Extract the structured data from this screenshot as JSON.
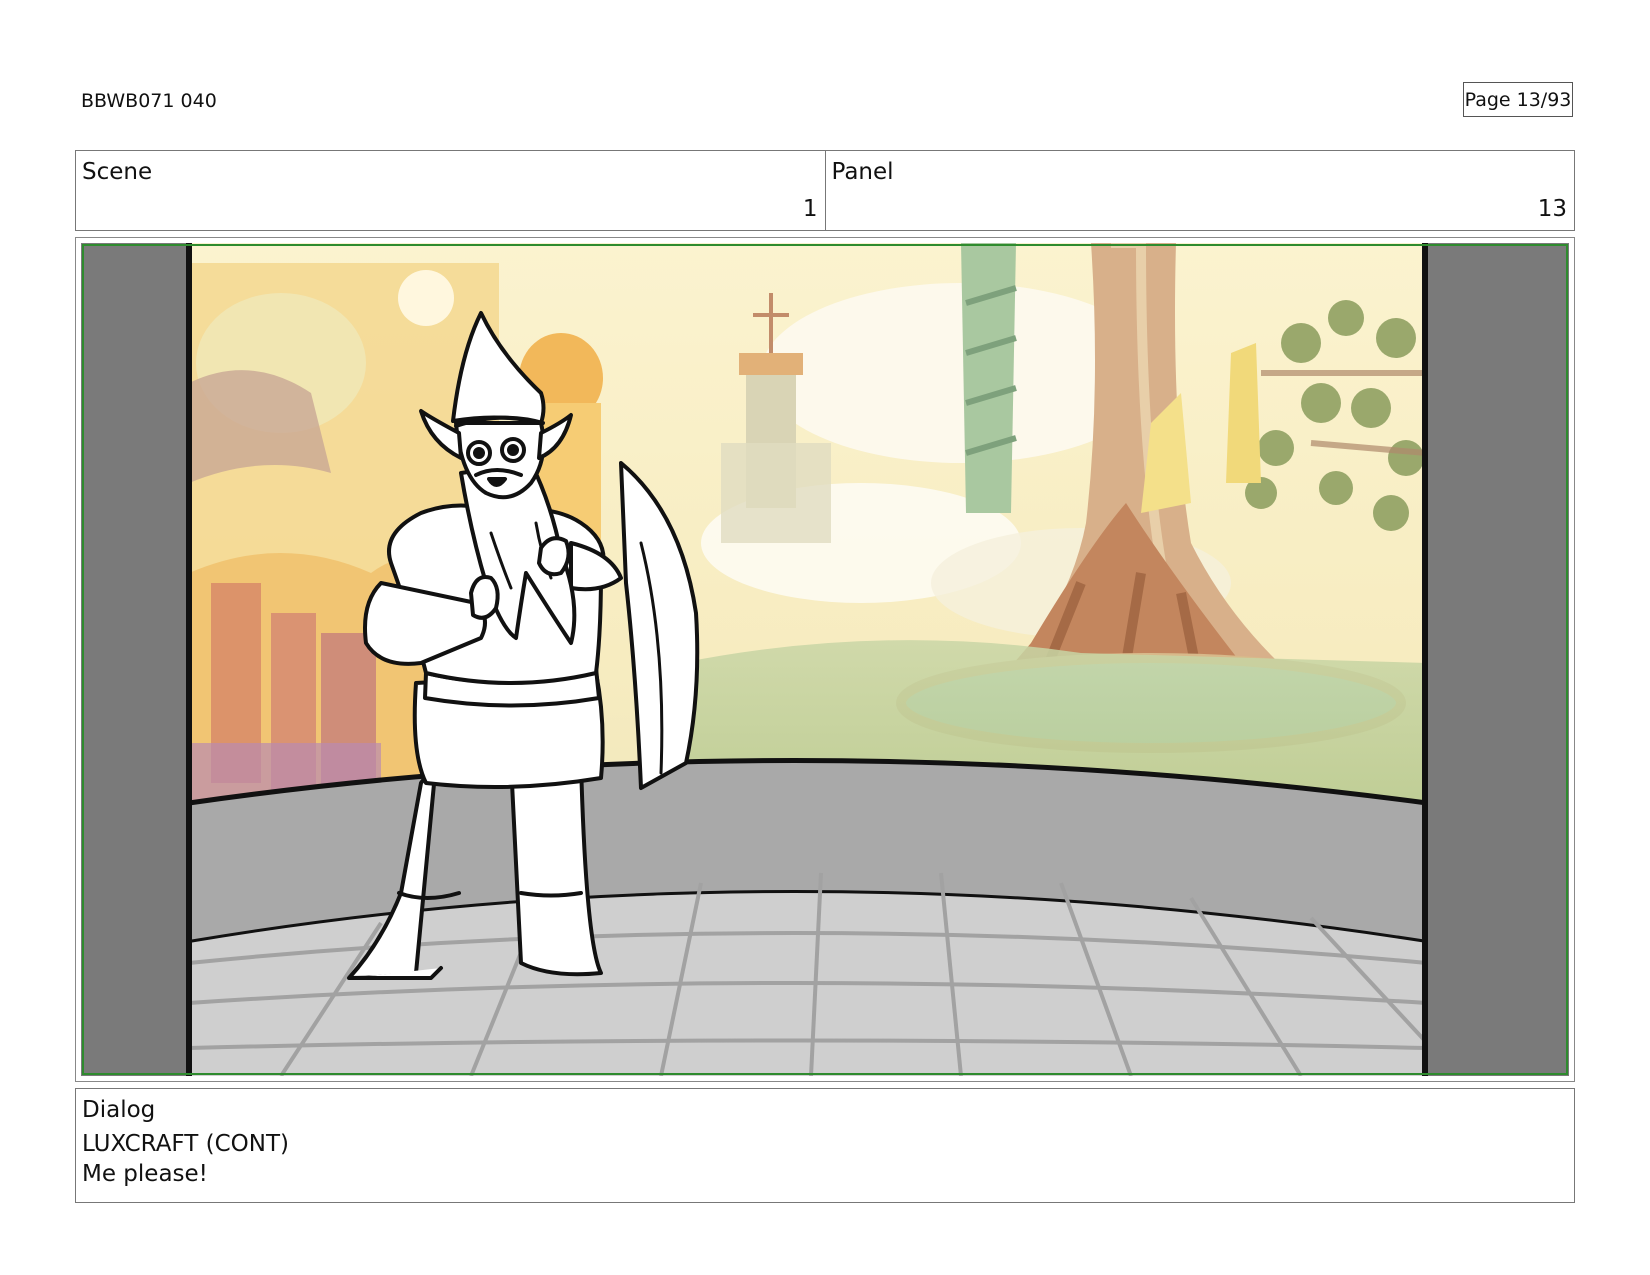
{
  "header": {
    "doc_id": "BBWB071 040",
    "page": "Page 13/93"
  },
  "scene": {
    "label": "Scene",
    "value": "1"
  },
  "panel": {
    "label": "Panel",
    "value": "13"
  },
  "frame": {
    "description_icon": "storyboard-frame",
    "safe_area_color": "#2e8b2e",
    "letterbox_color": "#7a7a7a"
  },
  "dialog": {
    "label": "Dialog",
    "speaker": "LUXCRAFT (CONT)",
    "line": "Me please!"
  }
}
